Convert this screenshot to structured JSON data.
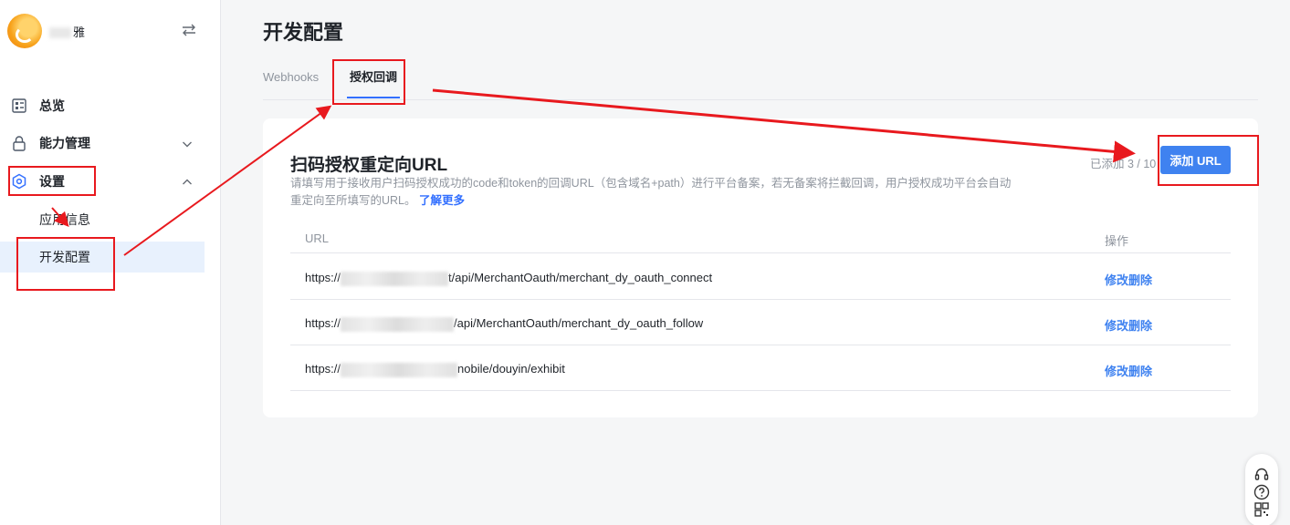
{
  "sidebar": {
    "brand": "雅",
    "items": [
      {
        "label": "总览",
        "icon": "dashboard-icon"
      },
      {
        "label": "能力管理",
        "icon": "lock-icon"
      },
      {
        "label": "设置",
        "icon": "settings-icon"
      }
    ],
    "sub_items": [
      {
        "label": "应用信息"
      },
      {
        "label": "开发配置"
      }
    ]
  },
  "page": {
    "title": "开发配置",
    "tabs": [
      {
        "label": "Webhooks"
      },
      {
        "label": "授权回调",
        "active": true
      }
    ]
  },
  "card": {
    "title": "扫码授权重定向URL",
    "description": "请填写用于接收用户扫码授权成功的code和token的回调URL（包含域名+path）进行平台备案，若无备案将拦截回调，用户授权成功平台会自动重定向至所填写的URL。",
    "learn_more": "了解更多",
    "count": "已添加 3 / 10",
    "add_button": "添加 URL",
    "columns": {
      "url": "URL",
      "action": "操作"
    },
    "rows": [
      {
        "prefix": "https://",
        "suffix": "t/api/MerchantOauth/merchant_dy_oauth_connect",
        "actions": "修改删除"
      },
      {
        "prefix": "https://",
        "suffix": "/api/MerchantOauth/merchant_dy_oauth_follow",
        "actions": "修改删除"
      },
      {
        "prefix": "https://",
        "suffix": "nobile/douyin/exhibit",
        "actions": "修改删除"
      }
    ]
  },
  "float_bar": {
    "icons": [
      "headset-icon",
      "help-icon",
      "qrcode-icon"
    ]
  },
  "colors": {
    "accent": "#3370ff",
    "button": "#3f82f0",
    "annotation": "#e8191e"
  }
}
